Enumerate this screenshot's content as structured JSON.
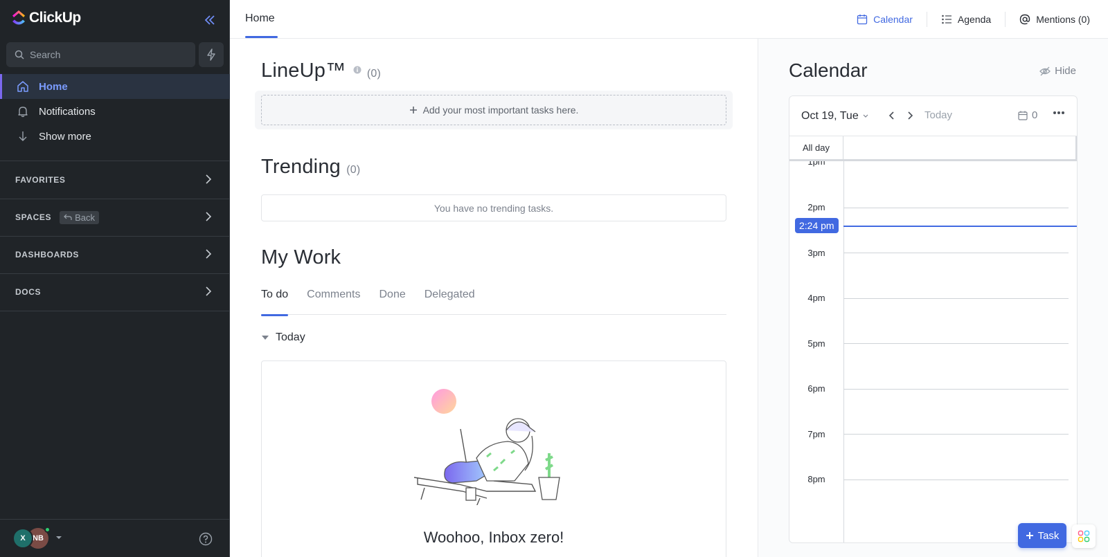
{
  "app": {
    "name": "ClickUp"
  },
  "sidebar": {
    "search_placeholder": "Search",
    "nav": [
      {
        "label": "Home",
        "icon": "home-icon",
        "active": true
      },
      {
        "label": "Notifications",
        "icon": "bell-icon"
      },
      {
        "label": "Show more",
        "icon": "arrow-down-icon"
      }
    ],
    "sections": [
      {
        "label": "FAVORITES"
      },
      {
        "label": "SPACES",
        "chip": "Back"
      },
      {
        "label": "DASHBOARDS"
      },
      {
        "label": "DOCS"
      }
    ],
    "footer": {
      "avatar_1": "X",
      "avatar_2": "NB"
    }
  },
  "topbar": {
    "tab": "Home",
    "actions": {
      "calendar": "Calendar",
      "agenda": "Agenda",
      "mentions": "Mentions (0)"
    }
  },
  "main": {
    "lineup": {
      "title": "LineUp™",
      "count": "(0)",
      "placeholder": "Add your most important tasks here."
    },
    "trending": {
      "title": "Trending",
      "count": "(0)",
      "empty": "You have no trending tasks."
    },
    "mywork": {
      "title": "My Work",
      "tabs": [
        "To do",
        "Comments",
        "Done",
        "Delegated"
      ],
      "group": "Today",
      "empty": "Woohoo, Inbox zero!"
    }
  },
  "calendar": {
    "title": "Calendar",
    "hide": "Hide",
    "date": "Oct 19, Tue",
    "today": "Today",
    "count": "0",
    "allday": "All day",
    "hours": [
      "1pm",
      "2pm",
      "3pm",
      "4pm",
      "5pm",
      "6pm",
      "7pm",
      "8pm"
    ],
    "now": "2:24 pm"
  },
  "fab": {
    "task": "Task"
  },
  "colors": {
    "accent": "#4169e1",
    "sidebar_bg": "#202428",
    "active_nav": "#7b9cff"
  }
}
